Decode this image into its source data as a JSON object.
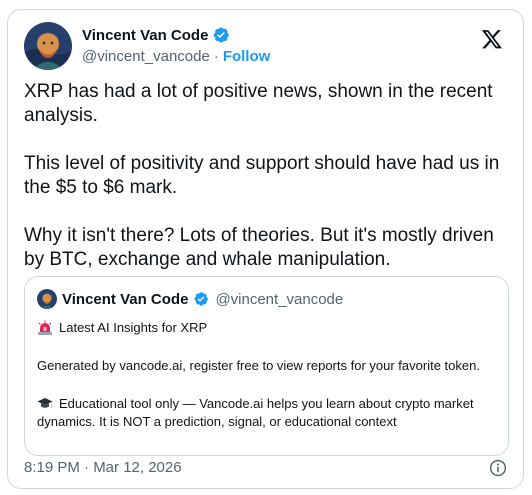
{
  "author": {
    "name": "Vincent Van Code",
    "handle": "@vincent_vancode",
    "separator": "·",
    "follow_label": "Follow"
  },
  "tweet": {
    "paragraphs": [
      "XRP has had a lot of positive news, shown in the recent analysis.",
      "This level of positivity and support should have had us in the $5 to $6 mark.",
      "Why it isn't there? Lots of theories. But it's mostly driven by BTC, exchange and whale manipulation."
    ],
    "timestamp": "8:19 PM · Mar 12, 2026"
  },
  "quoted": {
    "name": "Vincent Van Code",
    "handle": "@vincent_vancode",
    "title_line": "Latest AI Insights for XRP",
    "paragraph_1": "Generated by vancode.ai, register free to view reports for your favorite token.",
    "paragraph_2": "Educational tool only — Vancode.ai helps you learn about crypto market dynamics. It is NOT a prediction, signal, or educational context"
  },
  "icons": {
    "verified": "verified-badge-icon",
    "brand": "x-logo-icon",
    "siren": "siren-emoji-icon",
    "graduation": "graduation-cap-emoji-icon",
    "info": "info-icon"
  },
  "colors": {
    "accent": "#1d9bf0",
    "text": "#0f1419",
    "muted": "#536471",
    "border": "#cfd9de"
  }
}
